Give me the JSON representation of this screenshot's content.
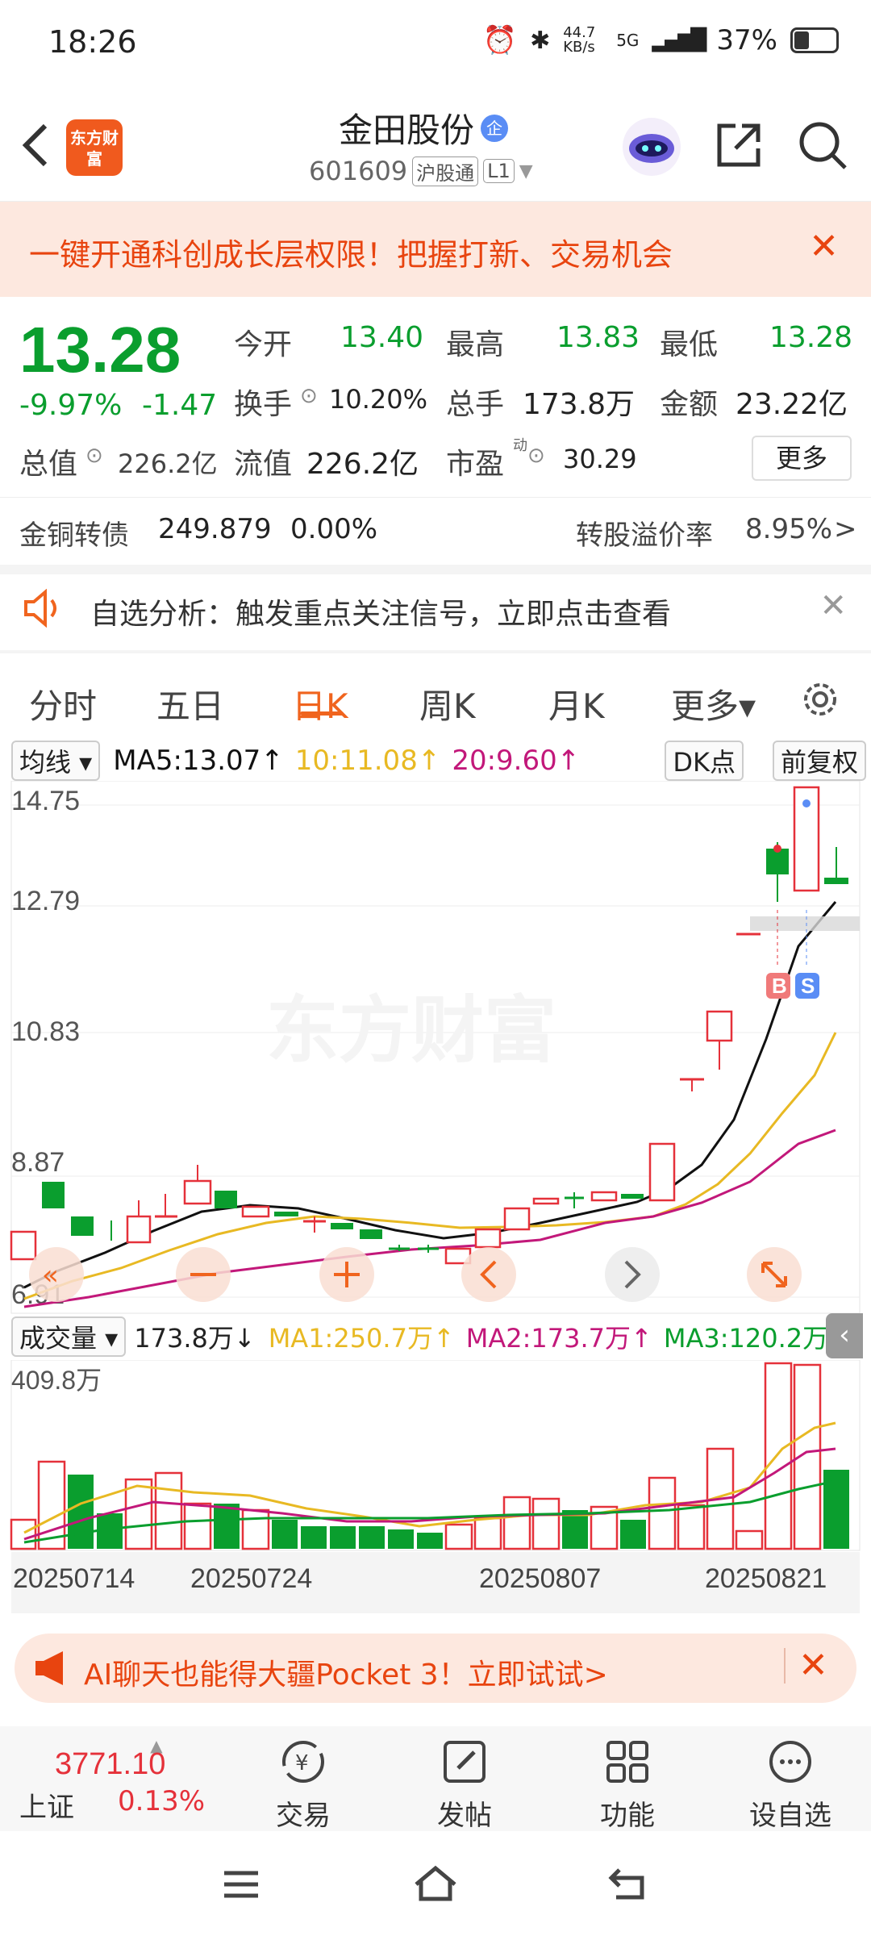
{
  "status": {
    "time": "18:26",
    "net_speed": "44.7 KB/s",
    "signal": "5G",
    "battery": "37%"
  },
  "header": {
    "logo_text": "东方财富",
    "stock_name": "金田股份",
    "badge": "企",
    "stock_code": "601609",
    "tag1": "沪股通",
    "tag2": "L1"
  },
  "banner_top": {
    "text": "一键开通科创成长层权限！把握打新、交易机会",
    "close": "✕"
  },
  "quote": {
    "price": "13.28",
    "change_pct": "-9.97%",
    "change": "-1.47",
    "open_label": "今开",
    "open": "13.40",
    "high_label": "最高",
    "high": "13.83",
    "low_label": "最低",
    "low": "13.28",
    "turnover_label": "换手",
    "turnover": "10.20%",
    "volume_label": "总手",
    "volume": "173.8万",
    "amount_label": "金额",
    "amount": "23.22亿",
    "mktcap_label": "总值",
    "mktcap": "226.2亿",
    "float_label": "流值",
    "float": "226.2亿",
    "pe_label": "市盈",
    "pe_sup": "动",
    "pe": "30.29",
    "more": "更多"
  },
  "bond": {
    "name": "金铜转债",
    "price": "249.879",
    "pct": "0.00%",
    "premium_label": "转股溢价率",
    "premium": "8.95%",
    "arrow": ">"
  },
  "notice": {
    "text": "自选分析：触发重点关注信号，立即点击查看",
    "close": "✕"
  },
  "tabs": [
    "分时",
    "五日",
    "日K",
    "周K",
    "月K",
    "更多▾"
  ],
  "ma_bar": {
    "selector": "均线 ▾",
    "ma5": "MA5:13.07↑",
    "ma10": "10:11.08↑",
    "ma20": "20:9.60↑",
    "dk": "DK点",
    "fq": "前复权"
  },
  "price_axis": [
    "14.75",
    "12.79",
    "10.83",
    "8.87",
    "6.91"
  ],
  "watermark": "东方财富",
  "markers": {
    "b": "B",
    "s": "S"
  },
  "vol_bar": {
    "selector": "成交量 ▾",
    "vol": "173.8万↓",
    "ma1": "MA1:250.7万↑",
    "ma2": "MA2:173.7万↑",
    "ma3": "MA3:120.2万↑"
  },
  "vol_axis": "409.8万",
  "dates": [
    "20250714",
    "20250724",
    "20250807",
    "20250821"
  ],
  "banner_ai": {
    "text": "AI聊天也能得大疆Pocket 3！立即试试>",
    "close": "✕"
  },
  "bottom": {
    "index_value": "3771.10",
    "index_name": "上证",
    "index_pct": "0.13%",
    "trade": "交易",
    "post": "发帖",
    "func": "功能",
    "watch": "设自选"
  },
  "colors": {
    "up": "#e5313a",
    "down": "#0a9e2e",
    "accent": "#f0641e",
    "ma5": "#111111",
    "ma10": "#e8b923",
    "ma20": "#c2187a"
  }
}
